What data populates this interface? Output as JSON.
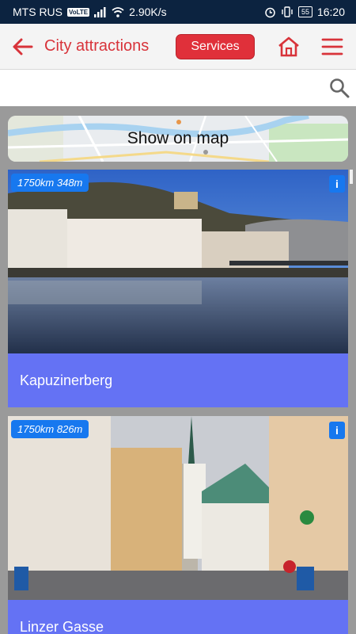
{
  "status_bar": {
    "carrier": "MTS RUS",
    "volte": "VoLTE",
    "speed": "2.90K/s",
    "battery": "55",
    "time": "16:20"
  },
  "app_bar": {
    "title": "City attractions",
    "services_label": "Services"
  },
  "search": {
    "placeholder": "",
    "value": ""
  },
  "map_button": {
    "label": "Show on map"
  },
  "attractions": [
    {
      "name": "Kapuzinerberg",
      "distance": "1750km 348m",
      "info": "i"
    },
    {
      "name": "Linzer Gasse",
      "distance": "1750km 826m",
      "info": "i"
    }
  ],
  "colors": {
    "status_bar_bg": "#0c2340",
    "accent_red": "#e0303a",
    "card_label_bg": "#6472f4",
    "badge_blue": "#1778ef"
  },
  "icons": {
    "back": "arrow-left-icon",
    "home": "home-icon",
    "menu": "hamburger-menu-icon",
    "search": "magnifier-icon",
    "info": "info-icon"
  }
}
